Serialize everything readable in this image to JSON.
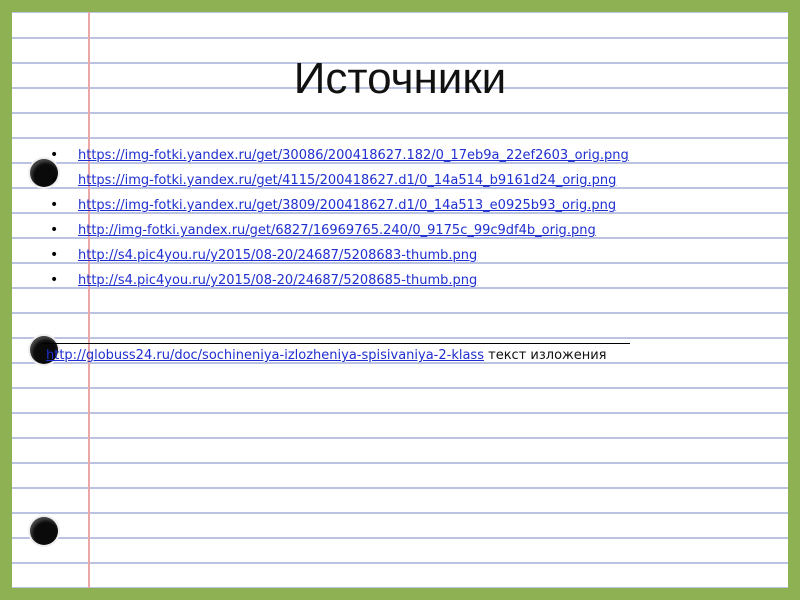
{
  "title": "Источники",
  "sources": [
    "https://img-fotki.yandex.ru/get/30086/200418627.182/0_17eb9a_22ef2603_orig.png",
    "https://img-fotki.yandex.ru/get/4115/200418627.d1/0_14a514_b9161d24_orig.png",
    "https://img-fotki.yandex.ru/get/3809/200418627.d1/0_14a513_e0925b93_orig.png",
    "http://img-fotki.yandex.ru/get/6827/16969765.240/0_9175c_99c9df4b_orig.png",
    "http://s4.pic4you.ru/y2015/08-20/24687/5208683-thumb.png",
    "http://s4.pic4you.ru/y2015/08-20/24687/5208685-thumb.png"
  ],
  "main_source": {
    "url": "http://globuss24.ru/doc/sochineniya-izlozheniya-spisivaniya-2-klass",
    "note": "текст изложения"
  },
  "colors": {
    "frame": "#8db153",
    "ruled_line": "#bcc3e2",
    "margin_line": "#e9a7a7",
    "link": "#1f2fd0"
  }
}
